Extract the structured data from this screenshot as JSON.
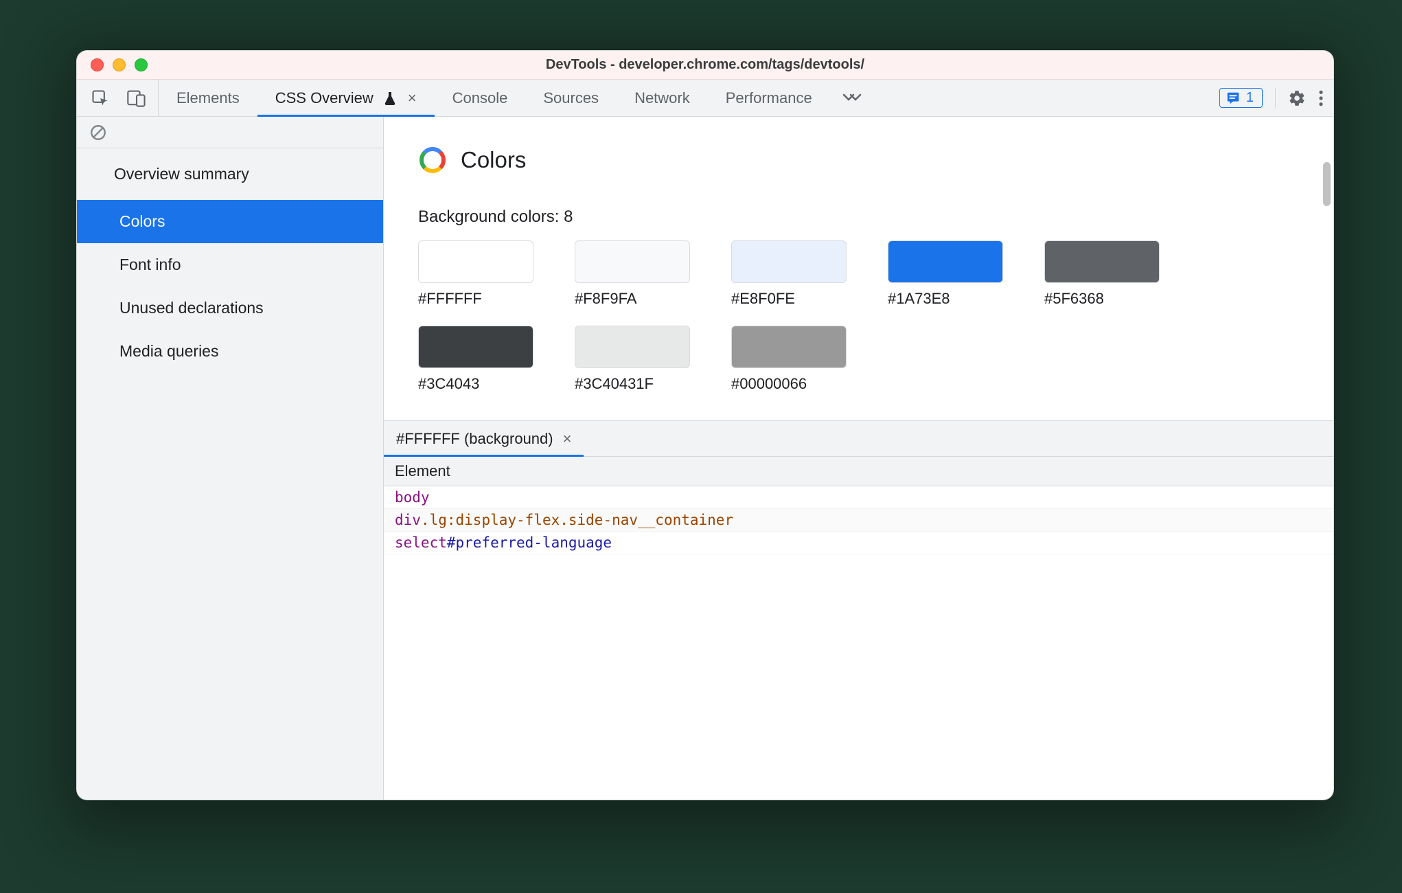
{
  "window": {
    "title": "DevTools - developer.chrome.com/tags/devtools/"
  },
  "tabs": {
    "items": [
      {
        "label": "Elements"
      },
      {
        "label": "CSS Overview"
      },
      {
        "label": "Console"
      },
      {
        "label": "Sources"
      },
      {
        "label": "Network"
      },
      {
        "label": "Performance"
      }
    ],
    "experiment_close": "×",
    "issues_count": "1"
  },
  "sidebar": {
    "heading": "Overview summary",
    "items": [
      {
        "label": "Colors",
        "selected": true
      },
      {
        "label": "Font info"
      },
      {
        "label": "Unused declarations"
      },
      {
        "label": "Media queries"
      }
    ]
  },
  "section": {
    "title": "Colors",
    "subtitle_prefix": "Background colors: ",
    "subtitle_count": "8",
    "swatches": [
      {
        "hex": "#FFFFFF",
        "css": "#FFFFFF"
      },
      {
        "hex": "#F8F9FA",
        "css": "#F8F9FA"
      },
      {
        "hex": "#E8F0FE",
        "css": "#E8F0FE"
      },
      {
        "hex": "#1A73E8",
        "css": "#1A73E8"
      },
      {
        "hex": "#5F6368",
        "css": "#5F6368"
      },
      {
        "hex": "#3C4043",
        "css": "#3C4043"
      },
      {
        "hex": "#3C40431F",
        "css": "rgba(60,64,67,0.12)"
      },
      {
        "hex": "#00000066",
        "css": "rgba(0,0,0,0.40)"
      }
    ]
  },
  "details": {
    "tab_label": "#FFFFFF (background)",
    "tab_close": "×",
    "table_header": "Element",
    "rows": [
      {
        "tag": "body",
        "rest": ""
      },
      {
        "tag": "div",
        "rest_class": ".lg:display-flex.side-nav__container"
      },
      {
        "tag": "select",
        "rest_id": "#preferred-language"
      }
    ]
  }
}
